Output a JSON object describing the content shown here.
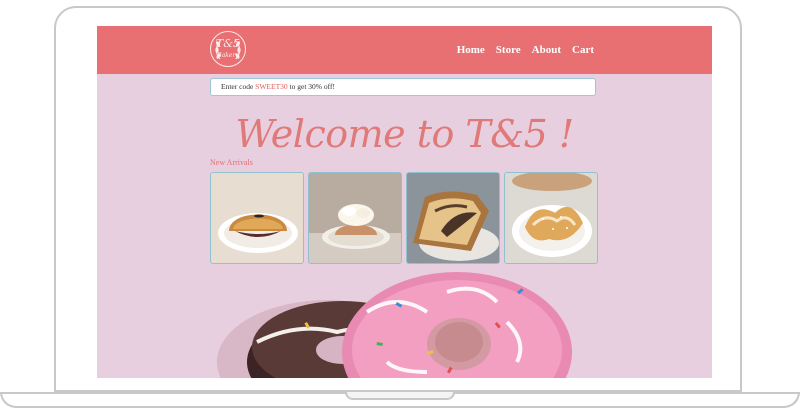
{
  "nav": {
    "logo": {
      "monogram": "T&5",
      "subtitle": "Bakery"
    },
    "links": [
      "Home",
      "Store",
      "About",
      "Cart"
    ]
  },
  "promo": {
    "prefix": "Enter code ",
    "code": "SWEET30",
    "suffix": " to get 30% off!"
  },
  "hero": {
    "title": "Welcome to T&5 !"
  },
  "arrivals": {
    "label": "New Arrivals",
    "items": [
      {
        "name": "red bean bun"
      },
      {
        "name": "cream pastry"
      },
      {
        "name": "chocolate loaf"
      },
      {
        "name": "sugar croissant"
      }
    ]
  },
  "colors": {
    "nav": "#e86f72",
    "accent": "#e07a78",
    "background": "#e8cfe0",
    "card_border": "#8fc1cf"
  },
  "icons": {
    "logo": "laurel-wreath-icon"
  }
}
